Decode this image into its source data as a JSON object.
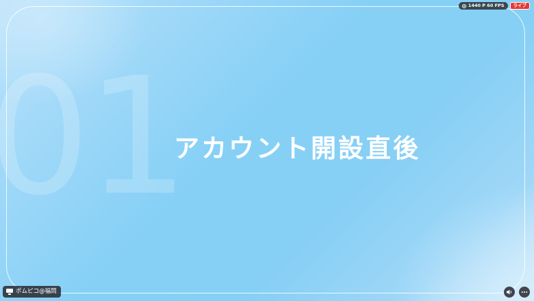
{
  "slide": {
    "number": "01",
    "title": "アカウント開設直後"
  },
  "stream": {
    "quality_label": "1440 P 60 FPS",
    "live_label": "ライブ"
  },
  "channel": {
    "name": "ポムピコ@福岡"
  },
  "controls": {
    "volume_icon": "volume-icon",
    "more_icon": "more-icon"
  },
  "colors": {
    "background": "#86d0f6",
    "live": "#e53935"
  }
}
